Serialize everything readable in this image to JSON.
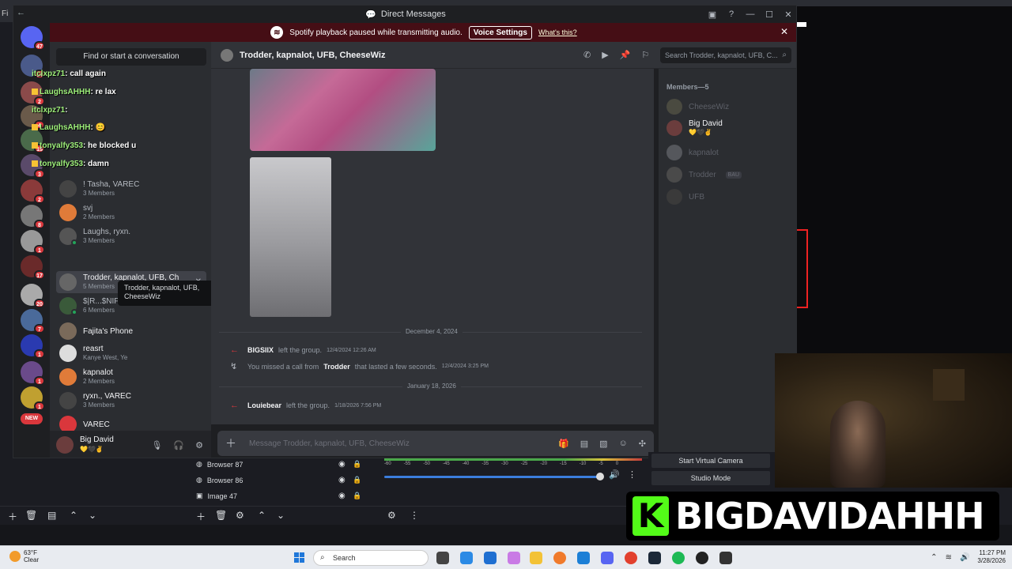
{
  "titlebar": {
    "title": "Direct Messages",
    "back": "←"
  },
  "banner": {
    "text": "Spotify playback paused while transmitting audio.",
    "button": "Voice Settings",
    "link": "What's this?"
  },
  "rail_badges": [
    "47",
    "14",
    "2",
    "4",
    "15",
    "3",
    "2",
    "8",
    "1",
    "17",
    "20",
    "7",
    "1",
    "1",
    "NEW"
  ],
  "sidebar": {
    "find": "Find or start a conversation",
    "dms": [
      {
        "name": "! Tasha, VAREC",
        "sub": "3 Members"
      },
      {
        "name": "svj",
        "sub": "2 Members"
      },
      {
        "name": "Laughs, ryxn.",
        "sub": "3 Members"
      },
      {
        "name": "Trodder, kapnalot, UFB, Ch",
        "sub": "5 Members"
      },
      {
        "name": "$|R...$ÑIFF$-Ā-ŁØT, PILL404, ...",
        "sub": "6 Members"
      },
      {
        "name": "Fajita's Phone",
        "sub": ""
      },
      {
        "name": "reasrt",
        "sub": "Kanye West, Ye",
        "tag": "ovo"
      },
      {
        "name": "kapnalot",
        "sub": "2 Members"
      },
      {
        "name": "ryxn., VAREC",
        "sub": "3 Members"
      },
      {
        "name": "VAREC",
        "sub": ""
      }
    ],
    "tooltip": "Trodder, kapnalot, UFB, CheeseWiz"
  },
  "user_panel": {
    "name": "Big David",
    "status": "💛🖤✌"
  },
  "chat_overlay": [
    {
      "user": "itclxpz71",
      "msg": "call again"
    },
    {
      "user": "LaughsAHHH",
      "msg": "re lax"
    },
    {
      "user": "itclxpz71",
      "msg": ""
    },
    {
      "user": "LaughsAHHH",
      "msg": "😊"
    },
    {
      "user": "tonyalfy353",
      "msg": "he blocked u"
    },
    {
      "user": "tonyalfy353",
      "msg": "damn"
    }
  ],
  "chat": {
    "title": "Trodder, kapnalot, UFB, CheeseWiz",
    "search_placeholder": "Search Trodder, kapnalot, UFB, C...",
    "input_placeholder": "Message Trodder, kapnalot, UFB, CheeseWiz",
    "date1": "December 4, 2024",
    "date2": "January 18, 2026",
    "msg1": {
      "who": "BIGSIIX",
      "text": "left the group.",
      "ts": "12/4/2024 12:26 AM"
    },
    "msg2": {
      "pre": "You missed a call from",
      "who": "Trodder",
      "text": "that lasted a few seconds.",
      "ts": "12/4/2024 3:25 PM"
    },
    "msg3": {
      "who": "Louiebear",
      "text": "left the group.",
      "ts": "1/18/2026 7:56 PM"
    }
  },
  "members": {
    "header": "Members—5",
    "list": [
      {
        "name": "CheeseWiz",
        "sub": "",
        "online": false
      },
      {
        "name": "Big David",
        "sub": "💛🖤✌",
        "online": true
      },
      {
        "name": "kapnalot",
        "sub": "",
        "online": false
      },
      {
        "name": "Trodder",
        "sub": "",
        "tag": "BAU",
        "online": false
      },
      {
        "name": "UFB",
        "sub": "",
        "online": false
      }
    ]
  },
  "obs": {
    "sources": [
      "Browser 87",
      "Browser 86",
      "Image 47"
    ],
    "mixer_scale": [
      "-60",
      "-55",
      "-50",
      "-45",
      "-40",
      "-35",
      "-30",
      "-25",
      "-20",
      "-15",
      "-10",
      "-5",
      "0"
    ],
    "controls": [
      "Start Virtual Camera",
      "Studio Mode"
    ],
    "volume": 0.8
  },
  "brand": {
    "k": "K",
    "name": "BIGDAVIDAHHH"
  },
  "taskbar": {
    "temp": "63°F",
    "weather": "Clear",
    "search": "Search",
    "time": "11:27 PM",
    "date": "3/28/2026"
  }
}
